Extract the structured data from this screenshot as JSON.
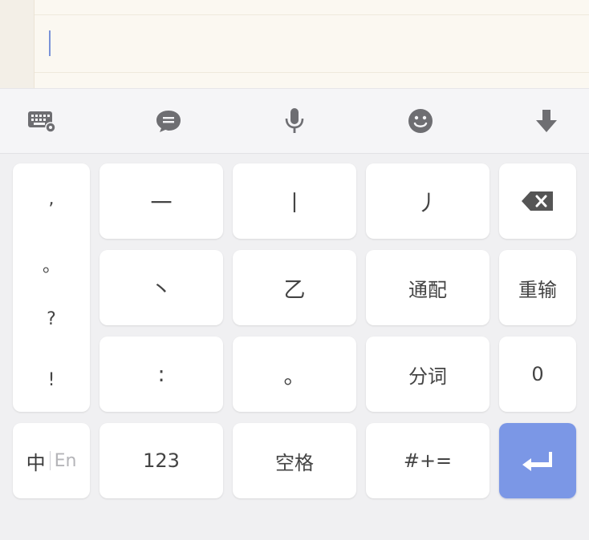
{
  "toolbar": {
    "icons": [
      "keyboard-settings-icon",
      "chat-bubble-icon",
      "microphone-icon",
      "emoji-icon",
      "collapse-keyboard-icon"
    ]
  },
  "keyboard": {
    "punctuation": [
      ",",
      "。",
      "?",
      "!"
    ],
    "stroke_keys": [
      "一",
      "丨",
      "丿",
      "丶",
      "乙"
    ],
    "wildcard": "通配",
    "split_word": "分词",
    "colon": ":",
    "period": "。",
    "retype": "重输",
    "zero": "0",
    "lang_zh": "中",
    "lang_en": "En",
    "numbers": "123",
    "space": "空格",
    "symbols": "#+="
  },
  "colors": {
    "enter_key": "#7b97e6",
    "caret": "#7a93d8"
  }
}
